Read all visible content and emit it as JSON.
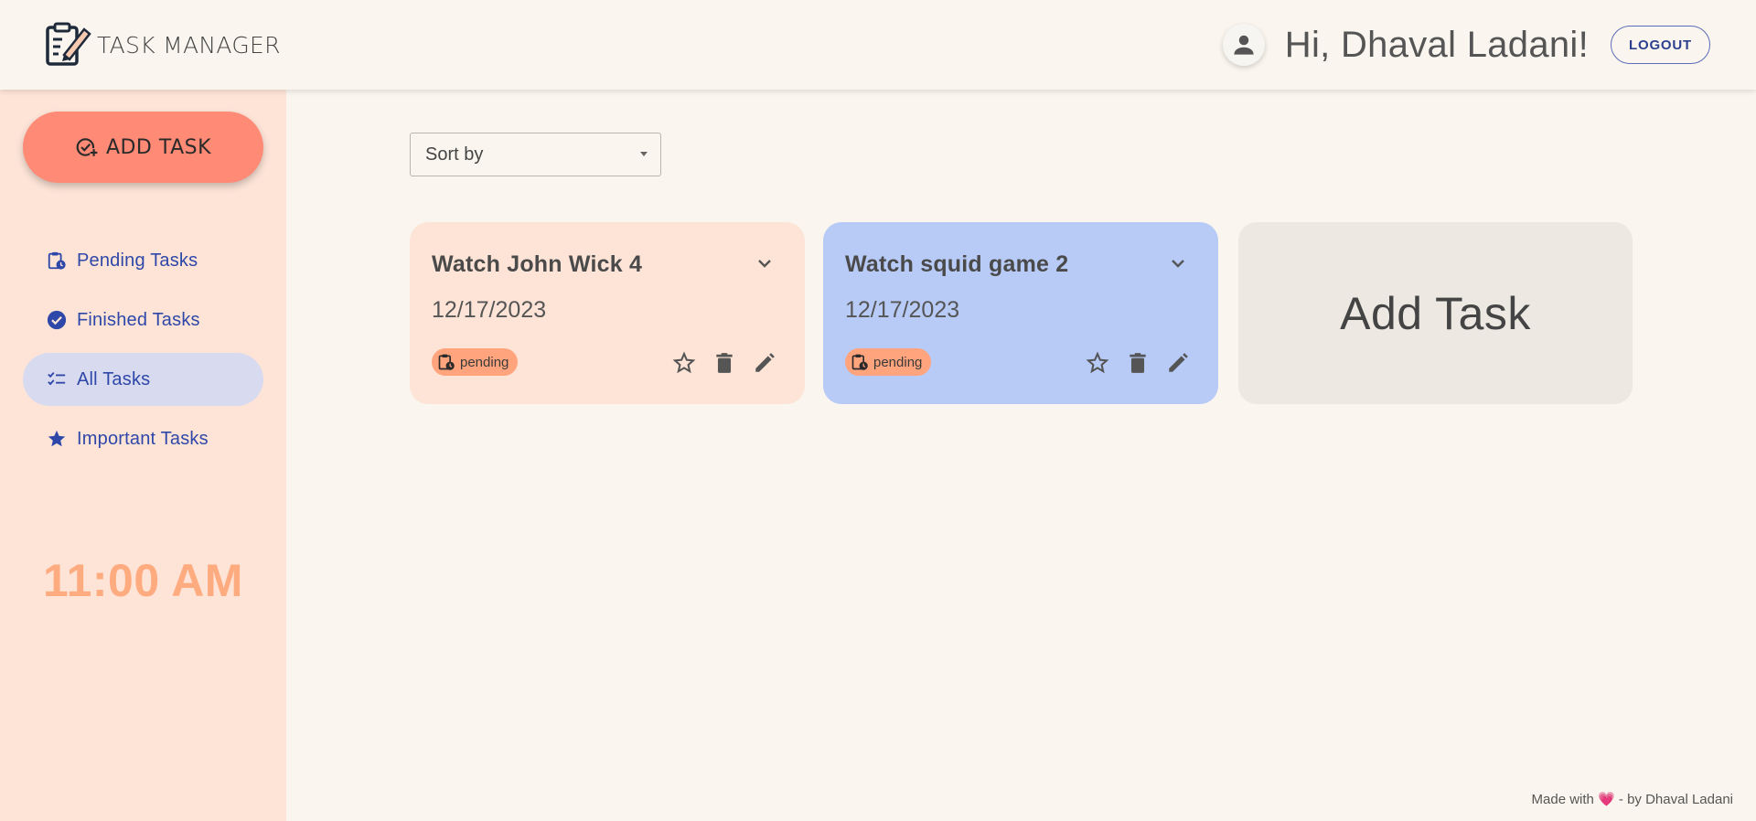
{
  "header": {
    "brand_name": "TASK MANAGER",
    "greeting": "Hi, Dhaval Ladani!",
    "logout_label": "LOGOUT"
  },
  "sidebar": {
    "add_task_label": "ADD TASK",
    "items": [
      {
        "label": "Pending Tasks",
        "icon": "pending-clipboard-icon",
        "active": false
      },
      {
        "label": "Finished Tasks",
        "icon": "check-circle-icon",
        "active": false
      },
      {
        "label": "All Tasks",
        "icon": "checklist-icon",
        "active": true
      },
      {
        "label": "Important Tasks",
        "icon": "star-icon",
        "active": false
      }
    ],
    "clock": "11:00 AM"
  },
  "main": {
    "sort": {
      "selected": "Sort by"
    },
    "cards": [
      {
        "title": "Watch John Wick 4",
        "date": "12/17/2023",
        "status": "pending",
        "color": "#fde4d7"
      },
      {
        "title": "Watch squid game 2",
        "date": "12/17/2023",
        "status": "pending",
        "color": "#b8cbf7"
      }
    ],
    "add_card_label": "Add Task"
  },
  "footer": {
    "prefix": "Made with",
    "heart": "💗",
    "suffix": "- by Dhaval Ladani"
  },
  "colors": {
    "accent_add": "#ff8a76",
    "chip": "#ffa47d",
    "nav_text": "#2e47a8",
    "clock": "#ffab80"
  }
}
